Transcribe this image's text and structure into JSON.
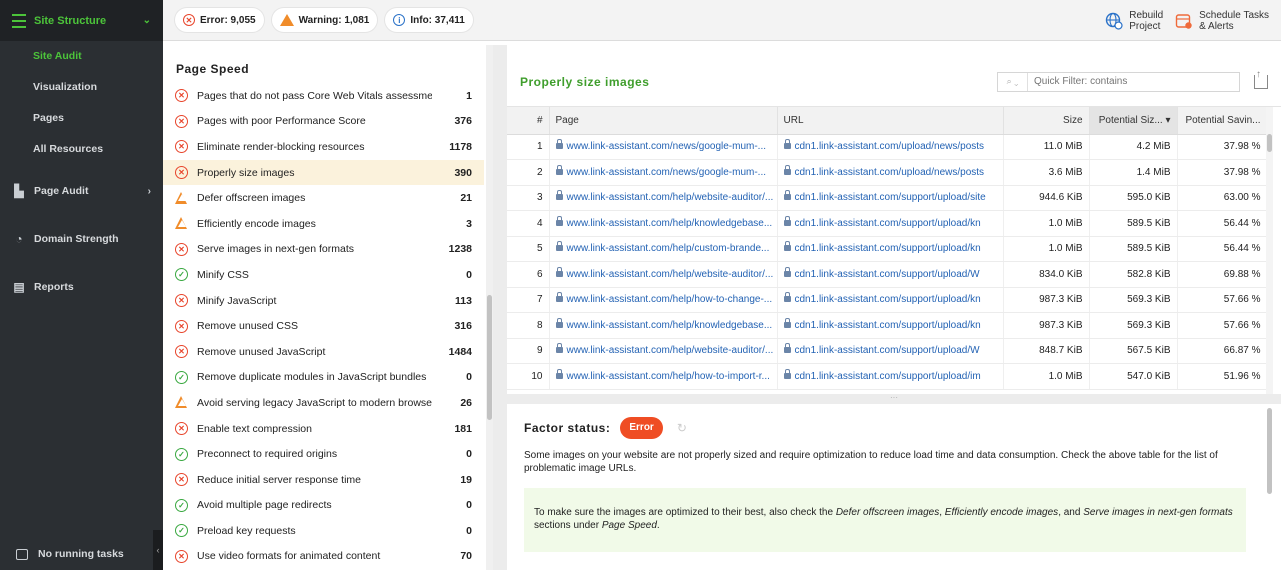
{
  "sidebar": {
    "header": "Site Structure",
    "sub_items": [
      "Site Audit",
      "Visualization",
      "Pages",
      "All Resources"
    ],
    "items": [
      {
        "label": "Page Audit",
        "icon": "page-audit-icon"
      },
      {
        "label": "Domain Strength",
        "icon": "gauge-icon"
      },
      {
        "label": "Reports",
        "icon": "reports-icon"
      }
    ],
    "footer": "No running tasks"
  },
  "topbar": {
    "error": "Error: 9,055",
    "warning": "Warning: 1,081",
    "info": "Info: 37,411",
    "rebuild": [
      "Rebuild",
      "Project"
    ],
    "schedule": [
      "Schedule Tasks",
      "& Alerts"
    ]
  },
  "list": {
    "title": "Page Speed",
    "items": [
      {
        "status": "error",
        "label": "Pages that do not pass Core Web Vitals assessment",
        "count": "1"
      },
      {
        "status": "error",
        "label": "Pages with poor Performance Score",
        "count": "376"
      },
      {
        "status": "error",
        "label": "Eliminate render-blocking resources",
        "count": "1178"
      },
      {
        "status": "error",
        "label": "Properly size images",
        "count": "390",
        "active": true
      },
      {
        "status": "warn",
        "label": "Defer offscreen images",
        "count": "21"
      },
      {
        "status": "warn",
        "label": "Efficiently encode images",
        "count": "3"
      },
      {
        "status": "error",
        "label": "Serve images in next-gen formats",
        "count": "1238"
      },
      {
        "status": "ok",
        "label": "Minify CSS",
        "count": "0"
      },
      {
        "status": "error",
        "label": "Minify JavaScript",
        "count": "113"
      },
      {
        "status": "error",
        "label": "Remove unused CSS",
        "count": "316"
      },
      {
        "status": "error",
        "label": "Remove unused JavaScript",
        "count": "1484"
      },
      {
        "status": "ok",
        "label": "Remove duplicate modules in JavaScript bundles",
        "count": "0"
      },
      {
        "status": "warn",
        "label": "Avoid serving legacy JavaScript to modern browsers",
        "count": "26"
      },
      {
        "status": "error",
        "label": "Enable text compression",
        "count": "181"
      },
      {
        "status": "ok",
        "label": "Preconnect to required origins",
        "count": "0"
      },
      {
        "status": "error",
        "label": "Reduce initial server response time",
        "count": "19"
      },
      {
        "status": "ok",
        "label": "Avoid multiple page redirects",
        "count": "0"
      },
      {
        "status": "ok",
        "label": "Preload key requests",
        "count": "0"
      },
      {
        "status": "error",
        "label": "Use video formats for animated content",
        "count": "70"
      }
    ]
  },
  "table": {
    "title": "Properly size images",
    "filter_placeholder": "Quick Filter: contains",
    "columns": [
      "#",
      "Page",
      "URL",
      "Size",
      "Potential Siz...",
      "Potential Savin..."
    ],
    "rows": [
      [
        "1",
        "www.link-assistant.com/news/google-mum-...",
        "cdn1.link-assistant.com/upload/news/posts",
        "11.0 MiB",
        "4.2 MiB",
        "37.98 %"
      ],
      [
        "2",
        "www.link-assistant.com/news/google-mum-...",
        "cdn1.link-assistant.com/upload/news/posts",
        "3.6 MiB",
        "1.4 MiB",
        "37.98 %"
      ],
      [
        "3",
        "www.link-assistant.com/help/website-auditor/...",
        "cdn1.link-assistant.com/support/upload/site",
        "944.6 KiB",
        "595.0 KiB",
        "63.00 %"
      ],
      [
        "4",
        "www.link-assistant.com/help/knowledgebase...",
        "cdn1.link-assistant.com/support/upload/kn",
        "1.0 MiB",
        "589.5 KiB",
        "56.44 %"
      ],
      [
        "5",
        "www.link-assistant.com/help/custom-brande...",
        "cdn1.link-assistant.com/support/upload/kn",
        "1.0 MiB",
        "589.5 KiB",
        "56.44 %"
      ],
      [
        "6",
        "www.link-assistant.com/help/website-auditor/...",
        "cdn1.link-assistant.com/support/upload/W",
        "834.0 KiB",
        "582.8 KiB",
        "69.88 %"
      ],
      [
        "7",
        "www.link-assistant.com/help/how-to-change-...",
        "cdn1.link-assistant.com/support/upload/kn",
        "987.3 KiB",
        "569.3 KiB",
        "57.66 %"
      ],
      [
        "8",
        "www.link-assistant.com/help/knowledgebase...",
        "cdn1.link-assistant.com/support/upload/kn",
        "987.3 KiB",
        "569.3 KiB",
        "57.66 %"
      ],
      [
        "9",
        "www.link-assistant.com/help/website-auditor/...",
        "cdn1.link-assistant.com/support/upload/W",
        "848.7 KiB",
        "567.5 KiB",
        "66.87 %"
      ],
      [
        "10",
        "www.link-assistant.com/help/how-to-import-r...",
        "cdn1.link-assistant.com/support/upload/im",
        "1.0 MiB",
        "547.0 KiB",
        "51.96 %"
      ]
    ]
  },
  "factor": {
    "label": "Factor status:",
    "badge": "Error",
    "text": "Some images on your website are not properly sized and require optimization to reduce load time and data consumption. Check the above table for the list of problematic image URLs.",
    "tip_prefix": "To make sure the images are optimized to their best, also check the ",
    "tip_links": [
      "Defer offscreen images",
      "Efficiently encode images",
      "Serve images in next-gen formats",
      "Page Speed"
    ],
    "tip_sep1": ", ",
    "tip_sep2": ", and ",
    "tip_mid": " sections under ",
    "tip_end": "."
  },
  "colors": {
    "accent_green": "#4cc43a",
    "error": "#e8452c",
    "warning": "#f08c2a",
    "ok": "#39a840",
    "link": "#2463b4"
  }
}
